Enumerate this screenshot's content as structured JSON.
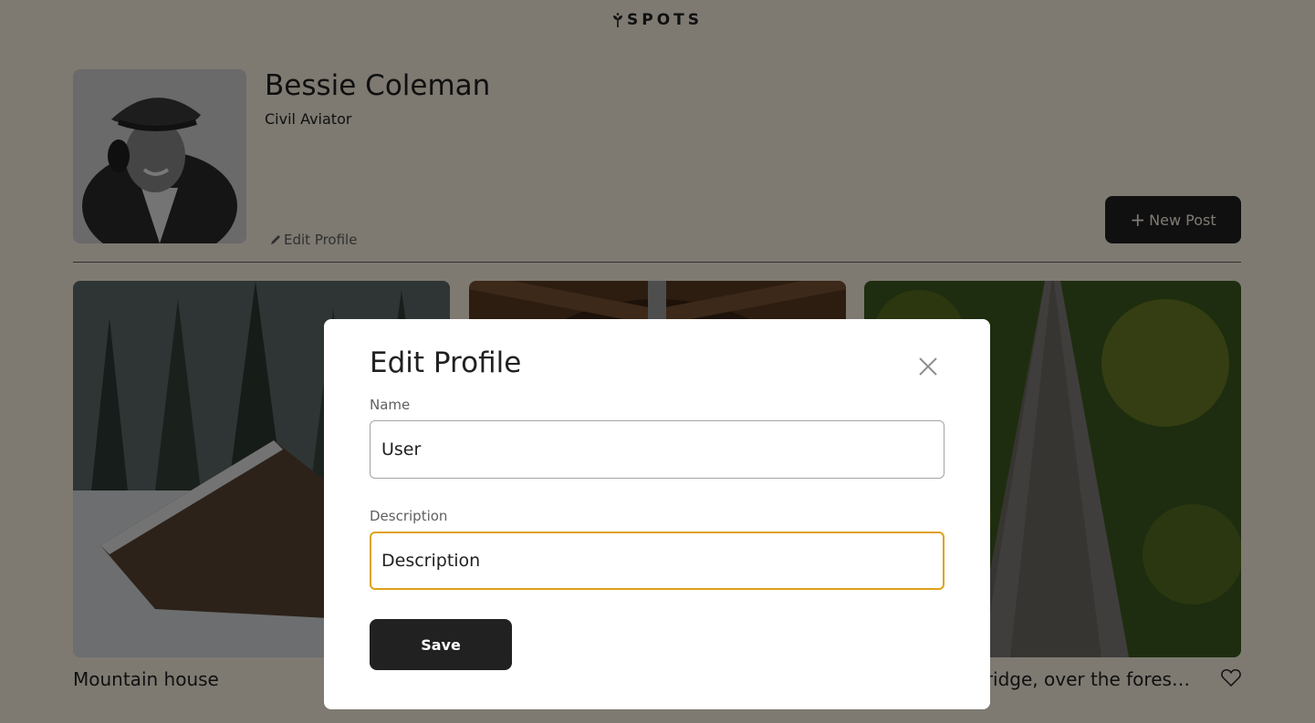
{
  "header": {
    "logo_text": "SPOTS"
  },
  "profile": {
    "name": "Bessie Coleman",
    "job": "Civil Aviator",
    "edit_label": "Edit Profile",
    "new_post_label": "New Post",
    "new_post_icon": "plus-icon",
    "edit_icon": "pencil-icon"
  },
  "cards": [
    {
      "title": "Mountain house"
    },
    {
      "title": ""
    },
    {
      "title": "A very long bridge, over the forest and through the trees"
    }
  ],
  "modal": {
    "title": "Edit Profile",
    "close_icon": "close-icon",
    "name_label": "Name",
    "name_value": "User",
    "description_label": "Description",
    "description_value": "Description",
    "save_label": "Save"
  },
  "colors": {
    "background": "#fcf5e5",
    "text": "#212121",
    "accent_focus": "#e0a11a",
    "overlay": "rgba(0,0,0,0.5)"
  }
}
